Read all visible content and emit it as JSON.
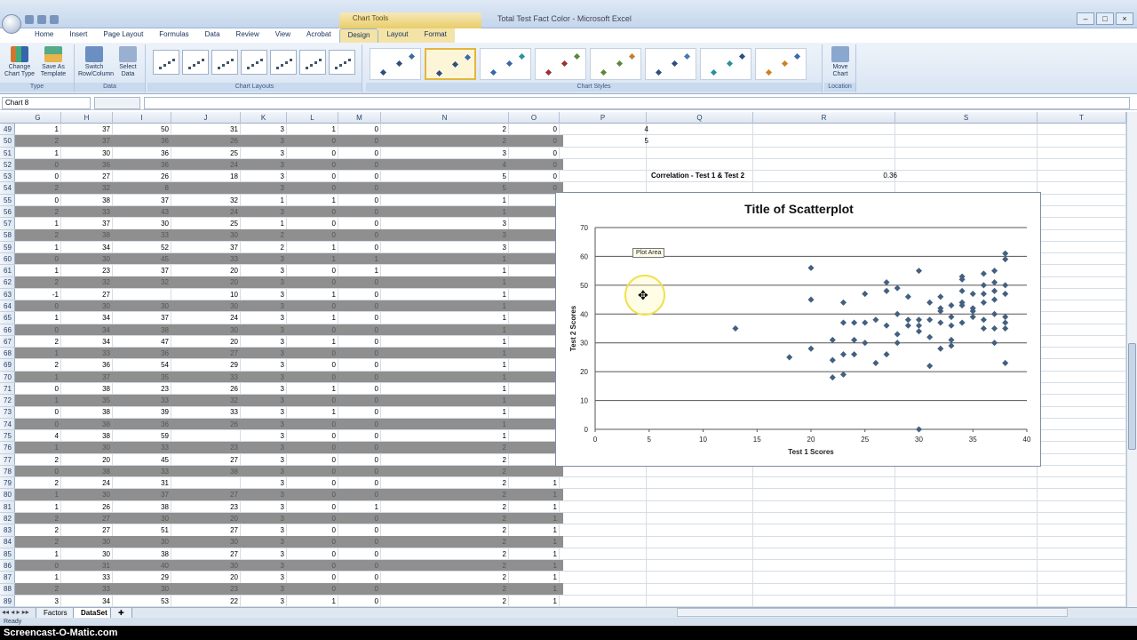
{
  "app": {
    "window_title": "Total Test Fact Color - Microsoft Excel",
    "context_tab_group": "Chart Tools"
  },
  "tabs": [
    "Home",
    "Insert",
    "Page Layout",
    "Formulas",
    "Data",
    "Review",
    "View",
    "Acrobat",
    "Design",
    "Layout",
    "Format"
  ],
  "active_tab": "Design",
  "ribbon": {
    "type_group": {
      "label": "Type",
      "change_chart_type": "Change Chart Type",
      "save_as_template": "Save As Template"
    },
    "data_group": {
      "label": "Data",
      "switch_row_column": "Switch Row/Column",
      "select_data": "Select Data"
    },
    "layouts_group": {
      "label": "Chart Layouts"
    },
    "styles_group": {
      "label": "Chart Styles"
    },
    "location_group": {
      "label": "Location",
      "move_chart": "Move Chart"
    }
  },
  "name_box": "Chart 8",
  "columns": [
    {
      "name": "G",
      "w": 52
    },
    {
      "name": "H",
      "w": 58
    },
    {
      "name": "I",
      "w": 66
    },
    {
      "name": "J",
      "w": 78
    },
    {
      "name": "K",
      "w": 52
    },
    {
      "name": "L",
      "w": 58
    },
    {
      "name": "M",
      "w": 48
    },
    {
      "name": "N",
      "w": 144
    },
    {
      "name": "O",
      "w": 57
    },
    {
      "name": "P",
      "w": 98
    },
    {
      "name": "Q",
      "w": 120
    },
    {
      "name": "R",
      "w": 160
    },
    {
      "name": "S",
      "w": 160
    },
    {
      "name": "T",
      "w": 100
    }
  ],
  "rows": [
    {
      "n": 49,
      "g": "1",
      "h": "37",
      "i": "50",
      "j": "31",
      "k": "3",
      "l": "1",
      "m": "0",
      "n2": "2",
      "o": "0"
    },
    {
      "n": 50,
      "g": "2",
      "h": "37",
      "i": "36",
      "j": "26",
      "k": "3",
      "l": "0",
      "m": "0",
      "n2": "2",
      "o": "0",
      "gray": true
    },
    {
      "n": 51,
      "g": "1",
      "h": "30",
      "i": "36",
      "j": "25",
      "k": "3",
      "l": "0",
      "m": "0",
      "n2": "3",
      "o": "0"
    },
    {
      "n": 52,
      "g": "0",
      "h": "36",
      "i": "36",
      "j": "24",
      "k": "3",
      "l": "0",
      "m": "0",
      "n2": "4",
      "o": "0",
      "gray": true
    },
    {
      "n": 53,
      "g": "0",
      "h": "27",
      "i": "26",
      "j": "18",
      "k": "3",
      "l": "0",
      "m": "0",
      "n2": "5",
      "o": "0"
    },
    {
      "n": 54,
      "g": "2",
      "h": "32",
      "i": "8",
      "j": "",
      "k": "3",
      "l": "0",
      "m": "0",
      "n2": "5",
      "o": "0",
      "gray": true
    },
    {
      "n": 55,
      "g": "0",
      "h": "38",
      "i": "37",
      "j": "32",
      "k": "1",
      "l": "1",
      "m": "0",
      "n2": "1",
      "o": ""
    },
    {
      "n": 56,
      "g": "2",
      "h": "33",
      "i": "43",
      "j": "24",
      "k": "3",
      "l": "0",
      "m": "0",
      "n2": "1",
      "o": "",
      "gray": true
    },
    {
      "n": 57,
      "g": "1",
      "h": "37",
      "i": "30",
      "j": "25",
      "k": "1",
      "l": "0",
      "m": "0",
      "n2": "3",
      "o": ""
    },
    {
      "n": 58,
      "g": "2",
      "h": "38",
      "i": "33",
      "j": "30",
      "k": "2",
      "l": "0",
      "m": "0",
      "n2": "3",
      "o": "",
      "gray": true
    },
    {
      "n": 59,
      "g": "1",
      "h": "34",
      "i": "52",
      "j": "37",
      "k": "2",
      "l": "1",
      "m": "0",
      "n2": "3",
      "o": ""
    },
    {
      "n": 60,
      "g": "0",
      "h": "30",
      "i": "45",
      "j": "33",
      "k": "3",
      "l": "1",
      "m": "1",
      "n2": "1",
      "o": "",
      "gray": true
    },
    {
      "n": 61,
      "g": "1",
      "h": "23",
      "i": "37",
      "j": "20",
      "k": "3",
      "l": "0",
      "m": "1",
      "n2": "1",
      "o": ""
    },
    {
      "n": 62,
      "g": "2",
      "h": "32",
      "i": "32",
      "j": "20",
      "k": "3",
      "l": "0",
      "m": "0",
      "n2": "1",
      "o": "",
      "gray": true
    },
    {
      "n": 63,
      "g": "-1",
      "h": "27",
      "i": "",
      "j": "10",
      "k": "3",
      "l": "1",
      "m": "0",
      "n2": "1",
      "o": ""
    },
    {
      "n": 64,
      "g": "0",
      "h": "30",
      "i": "30",
      "j": "30",
      "k": "3",
      "l": "0",
      "m": "0",
      "n2": "1",
      "o": "",
      "gray": true
    },
    {
      "n": 65,
      "g": "1",
      "h": "34",
      "i": "37",
      "j": "24",
      "k": "3",
      "l": "1",
      "m": "0",
      "n2": "1",
      "o": ""
    },
    {
      "n": 66,
      "g": "0",
      "h": "34",
      "i": "38",
      "j": "30",
      "k": "3",
      "l": "0",
      "m": "0",
      "n2": "1",
      "o": "",
      "gray": true
    },
    {
      "n": 67,
      "g": "2",
      "h": "34",
      "i": "47",
      "j": "20",
      "k": "3",
      "l": "1",
      "m": "0",
      "n2": "1",
      "o": ""
    },
    {
      "n": 68,
      "g": "1",
      "h": "33",
      "i": "36",
      "j": "27",
      "k": "3",
      "l": "0",
      "m": "0",
      "n2": "1",
      "o": "",
      "gray": true
    },
    {
      "n": 69,
      "g": "2",
      "h": "36",
      "i": "54",
      "j": "29",
      "k": "3",
      "l": "0",
      "m": "0",
      "n2": "1",
      "o": ""
    },
    {
      "n": 70,
      "g": "1",
      "h": "37",
      "i": "35",
      "j": "33",
      "k": "3",
      "l": "0",
      "m": "0",
      "n2": "1",
      "o": "",
      "gray": true
    },
    {
      "n": 71,
      "g": "0",
      "h": "38",
      "i": "23",
      "j": "26",
      "k": "3",
      "l": "1",
      "m": "0",
      "n2": "1",
      "o": ""
    },
    {
      "n": 72,
      "g": "1",
      "h": "35",
      "i": "33",
      "j": "32",
      "k": "3",
      "l": "0",
      "m": "0",
      "n2": "1",
      "o": "",
      "gray": true
    },
    {
      "n": 73,
      "g": "0",
      "h": "38",
      "i": "39",
      "j": "33",
      "k": "3",
      "l": "1",
      "m": "0",
      "n2": "1",
      "o": ""
    },
    {
      "n": 74,
      "g": "0",
      "h": "38",
      "i": "36",
      "j": "26",
      "k": "3",
      "l": "0",
      "m": "0",
      "n2": "1",
      "o": "",
      "gray": true
    },
    {
      "n": 75,
      "g": "4",
      "h": "38",
      "i": "59",
      "j": "",
      "k": "3",
      "l": "0",
      "m": "0",
      "n2": "1",
      "o": ""
    },
    {
      "n": 76,
      "g": "1",
      "h": "30",
      "i": "33",
      "j": "23",
      "k": "3",
      "l": "0",
      "m": "0",
      "n2": "2",
      "o": "",
      "gray": true
    },
    {
      "n": 77,
      "g": "2",
      "h": "20",
      "i": "45",
      "j": "27",
      "k": "3",
      "l": "0",
      "m": "0",
      "n2": "2",
      "o": ""
    },
    {
      "n": 78,
      "g": "0",
      "h": "38",
      "i": "33",
      "j": "38",
      "k": "3",
      "l": "0",
      "m": "0",
      "n2": "2",
      "o": "",
      "gray": true
    },
    {
      "n": 79,
      "g": "2",
      "h": "24",
      "i": "31",
      "j": "",
      "k": "3",
      "l": "0",
      "m": "0",
      "n2": "2",
      "o": "1"
    },
    {
      "n": 80,
      "g": "1",
      "h": "30",
      "i": "37",
      "j": "27",
      "k": "3",
      "l": "0",
      "m": "0",
      "n2": "2",
      "o": "1",
      "gray": true
    },
    {
      "n": 81,
      "g": "1",
      "h": "26",
      "i": "38",
      "j": "23",
      "k": "3",
      "l": "0",
      "m": "1",
      "n2": "2",
      "o": "1"
    },
    {
      "n": 82,
      "g": "2",
      "h": "27",
      "i": "30",
      "j": "20",
      "k": "3",
      "l": "0",
      "m": "0",
      "n2": "2",
      "o": "1",
      "gray": true
    },
    {
      "n": 83,
      "g": "2",
      "h": "27",
      "i": "51",
      "j": "27",
      "k": "3",
      "l": "0",
      "m": "0",
      "n2": "2",
      "o": "1"
    },
    {
      "n": 84,
      "g": "2",
      "h": "30",
      "i": "30",
      "j": "30",
      "k": "3",
      "l": "0",
      "m": "0",
      "n2": "2",
      "o": "1",
      "gray": true
    },
    {
      "n": 85,
      "g": "1",
      "h": "30",
      "i": "38",
      "j": "27",
      "k": "3",
      "l": "0",
      "m": "0",
      "n2": "2",
      "o": "1"
    },
    {
      "n": 86,
      "g": "0",
      "h": "31",
      "i": "40",
      "j": "30",
      "k": "3",
      "l": "0",
      "m": "0",
      "n2": "2",
      "o": "1",
      "gray": true
    },
    {
      "n": 87,
      "g": "1",
      "h": "33",
      "i": "29",
      "j": "20",
      "k": "3",
      "l": "0",
      "m": "0",
      "n2": "2",
      "o": "1"
    },
    {
      "n": 88,
      "g": "2",
      "h": "33",
      "i": "30",
      "j": "23",
      "k": "3",
      "l": "0",
      "m": "0",
      "n2": "2",
      "o": "1",
      "gray": true
    },
    {
      "n": 89,
      "g": "3",
      "h": "34",
      "i": "53",
      "j": "22",
      "k": "3",
      "l": "1",
      "m": "0",
      "n2": "2",
      "o": "1"
    }
  ],
  "side_values": {
    "p49": "4",
    "p50": "5"
  },
  "correlation": {
    "label": "Correlation - Test 1 & Test 2",
    "value": "0.36"
  },
  "tooltip": "Plot Area",
  "sheet_tabs": [
    "Factors",
    "DataSet"
  ],
  "active_sheet": "DataSet",
  "status": "Ready",
  "watermark": "Screencast-O-Matic.com",
  "colors": {
    "marker": "#44607f",
    "accent": "#e3b63c"
  },
  "chart_data": {
    "type": "scatter",
    "title": "Title of Scatterplot",
    "xlabel": "Test 1 Scores",
    "ylabel": "Test 2 Scores",
    "xlim": [
      0,
      40
    ],
    "ylim": [
      0,
      70
    ],
    "xticks": [
      0,
      5,
      10,
      15,
      20,
      25,
      30,
      35,
      40
    ],
    "yticks": [
      0,
      10,
      20,
      30,
      40,
      50,
      60,
      70
    ],
    "grid": "horizontal",
    "legend": "none",
    "points": [
      [
        13,
        35
      ],
      [
        18,
        25
      ],
      [
        20,
        56
      ],
      [
        20,
        45
      ],
      [
        20,
        28
      ],
      [
        22,
        31
      ],
      [
        22,
        24
      ],
      [
        22,
        18
      ],
      [
        23,
        44
      ],
      [
        23,
        37
      ],
      [
        23,
        26
      ],
      [
        23,
        19
      ],
      [
        24,
        37
      ],
      [
        24,
        31
      ],
      [
        24,
        26
      ],
      [
        25,
        47
      ],
      [
        25,
        37
      ],
      [
        25,
        30
      ],
      [
        26,
        38
      ],
      [
        26,
        23
      ],
      [
        27,
        51
      ],
      [
        27,
        48
      ],
      [
        27,
        36
      ],
      [
        27,
        26
      ],
      [
        28,
        49
      ],
      [
        28,
        40
      ],
      [
        28,
        33
      ],
      [
        28,
        30
      ],
      [
        29,
        46
      ],
      [
        29,
        38
      ],
      [
        29,
        36
      ],
      [
        30,
        55
      ],
      [
        30,
        38
      ],
      [
        30,
        36
      ],
      [
        30,
        34
      ],
      [
        30,
        0
      ],
      [
        31,
        44
      ],
      [
        31,
        38
      ],
      [
        31,
        32
      ],
      [
        31,
        22
      ],
      [
        32,
        46
      ],
      [
        32,
        42
      ],
      [
        32,
        41
      ],
      [
        32,
        37
      ],
      [
        32,
        28
      ],
      [
        33,
        43
      ],
      [
        33,
        39
      ],
      [
        33,
        36
      ],
      [
        33,
        31
      ],
      [
        33,
        29
      ],
      [
        34,
        53
      ],
      [
        34,
        52
      ],
      [
        34,
        48
      ],
      [
        34,
        44
      ],
      [
        34,
        43
      ],
      [
        34,
        37
      ],
      [
        35,
        47
      ],
      [
        35,
        42
      ],
      [
        35,
        41
      ],
      [
        35,
        39
      ],
      [
        36,
        54
      ],
      [
        36,
        50
      ],
      [
        36,
        47
      ],
      [
        36,
        44
      ],
      [
        36,
        38
      ],
      [
        36,
        35
      ],
      [
        37,
        55
      ],
      [
        37,
        51
      ],
      [
        37,
        48
      ],
      [
        37,
        45
      ],
      [
        37,
        40
      ],
      [
        37,
        35
      ],
      [
        37,
        30
      ],
      [
        38,
        61
      ],
      [
        38,
        59
      ],
      [
        38,
        50
      ],
      [
        38,
        47
      ],
      [
        38,
        39
      ],
      [
        38,
        37
      ],
      [
        38,
        35
      ],
      [
        38,
        23
      ]
    ]
  }
}
